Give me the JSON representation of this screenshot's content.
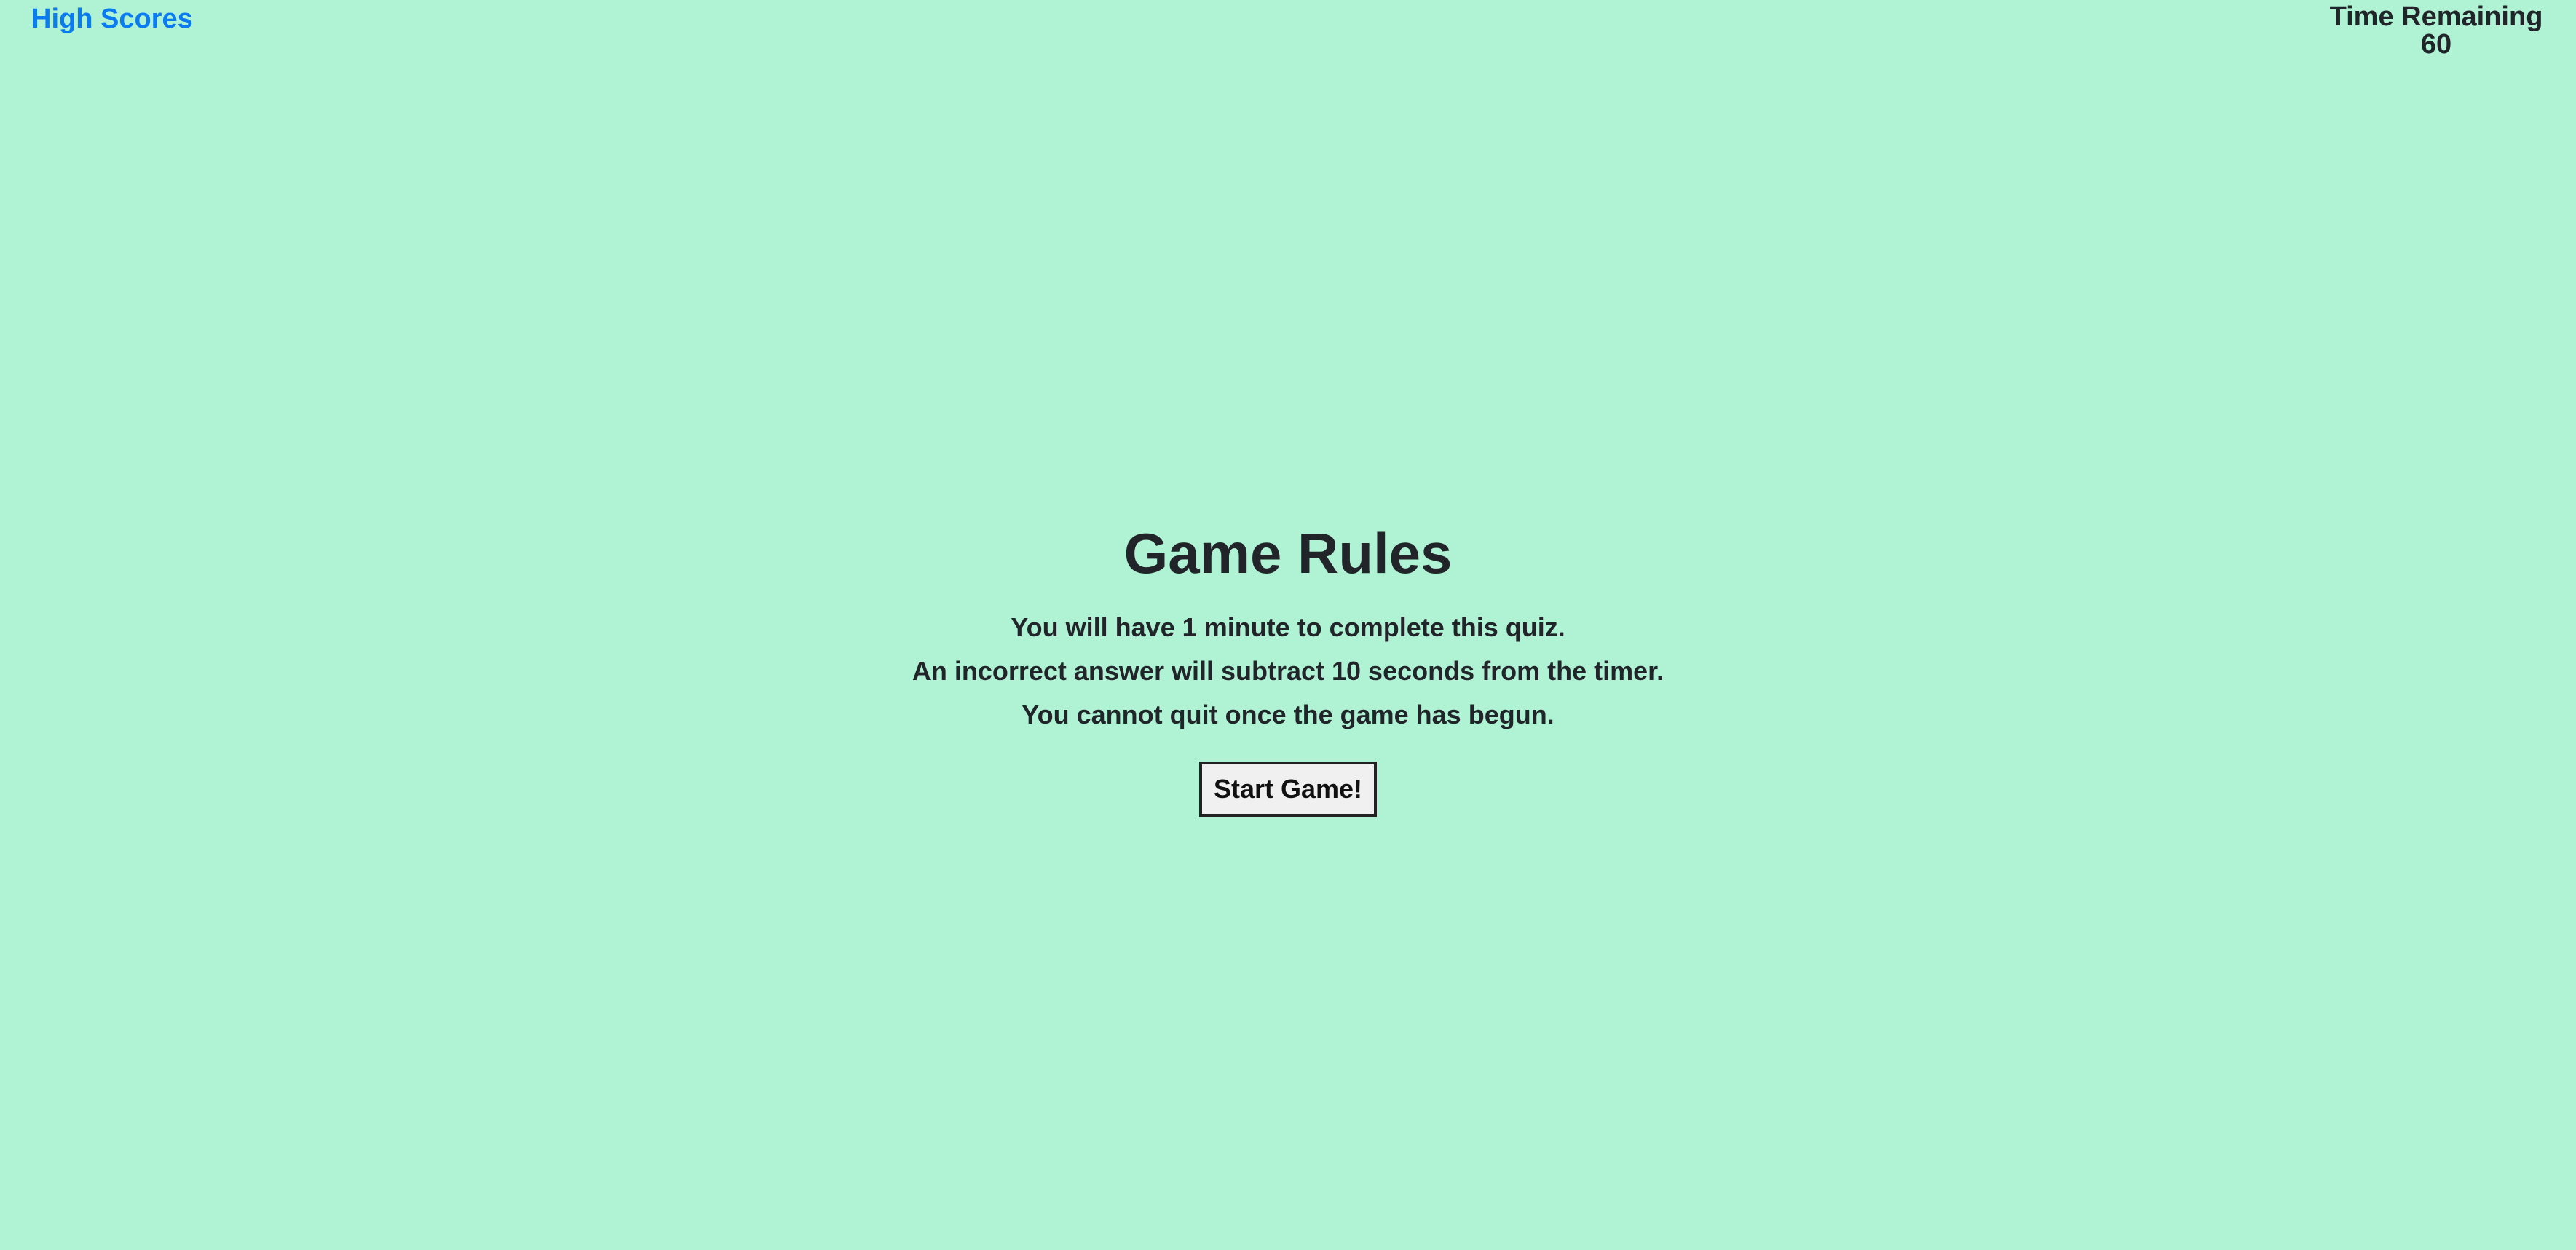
{
  "header": {
    "high_scores_label": "High Scores",
    "timer_label": "Time Remaining",
    "timer_value": "60"
  },
  "rules": {
    "title": "Game Rules",
    "items": [
      "You will have 1 minute to complete this quiz.",
      "An incorrect answer will subtract 10 seconds from the timer.",
      "You cannot quit once the game has begun."
    ],
    "start_button_label": "Start Game!"
  },
  "colors": {
    "background": "#aff2d4",
    "link": "#0a7bf0",
    "text": "#212529"
  }
}
